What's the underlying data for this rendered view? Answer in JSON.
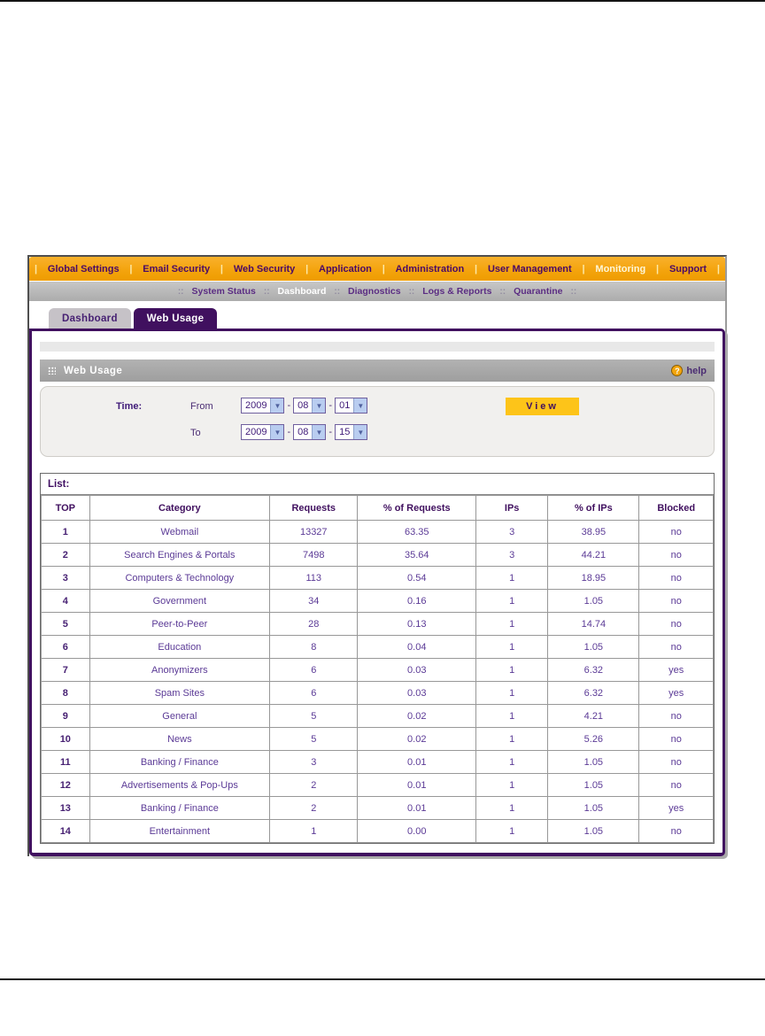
{
  "nav": {
    "separator": "|",
    "items": [
      {
        "label": "Global Settings",
        "active": false
      },
      {
        "label": "Email Security",
        "active": false
      },
      {
        "label": "Web Security",
        "active": false
      },
      {
        "label": "Application",
        "active": false
      },
      {
        "label": "Administration",
        "active": false
      },
      {
        "label": "User Management",
        "active": false
      },
      {
        "label": "Monitoring",
        "active": true
      },
      {
        "label": "Support",
        "active": false
      }
    ]
  },
  "subnav": {
    "separator": "::",
    "items": [
      {
        "label": "System Status",
        "active": false
      },
      {
        "label": "Dashboard",
        "active": true
      },
      {
        "label": "Diagnostics",
        "active": false
      },
      {
        "label": "Logs & Reports",
        "active": false
      },
      {
        "label": "Quarantine",
        "active": false
      }
    ]
  },
  "tabs": [
    {
      "label": "Dashboard",
      "active": false
    },
    {
      "label": "Web Usage",
      "active": true
    }
  ],
  "section": {
    "title": "Web Usage",
    "help_icon": "?",
    "help_label": "help"
  },
  "time_filter": {
    "label": "Time:",
    "from_label": "From",
    "to_label": "To",
    "separator": "-",
    "from": {
      "year": "2009",
      "month": "08",
      "day": "01"
    },
    "to": {
      "year": "2009",
      "month": "08",
      "day": "15"
    },
    "view_button": "View"
  },
  "list": {
    "label": "List:",
    "columns": [
      "TOP",
      "Category",
      "Requests",
      "% of Requests",
      "IPs",
      "% of IPs",
      "Blocked"
    ],
    "rows": [
      [
        "1",
        "Webmail",
        "13327",
        "63.35",
        "3",
        "38.95",
        "no"
      ],
      [
        "2",
        "Search Engines & Portals",
        "7498",
        "35.64",
        "3",
        "44.21",
        "no"
      ],
      [
        "3",
        "Computers & Technology",
        "113",
        "0.54",
        "1",
        "18.95",
        "no"
      ],
      [
        "4",
        "Government",
        "34",
        "0.16",
        "1",
        "1.05",
        "no"
      ],
      [
        "5",
        "Peer-to-Peer",
        "28",
        "0.13",
        "1",
        "14.74",
        "no"
      ],
      [
        "6",
        "Education",
        "8",
        "0.04",
        "1",
        "1.05",
        "no"
      ],
      [
        "7",
        "Anonymizers",
        "6",
        "0.03",
        "1",
        "6.32",
        "yes"
      ],
      [
        "8",
        "Spam Sites",
        "6",
        "0.03",
        "1",
        "6.32",
        "yes"
      ],
      [
        "9",
        "General",
        "5",
        "0.02",
        "1",
        "4.21",
        "no"
      ],
      [
        "10",
        "News",
        "5",
        "0.02",
        "1",
        "5.26",
        "no"
      ],
      [
        "11",
        "Banking / Finance",
        "3",
        "0.01",
        "1",
        "1.05",
        "no"
      ],
      [
        "12",
        "Advertisements & Pop-Ups",
        "2",
        "0.01",
        "1",
        "1.05",
        "no"
      ],
      [
        "13",
        "Banking / Finance",
        "2",
        "0.01",
        "1",
        "1.05",
        "yes"
      ],
      [
        "14",
        "Entertainment",
        "1",
        "0.00",
        "1",
        "1.05",
        "no"
      ]
    ]
  },
  "colors": {
    "nav_orange": "#f4a40e",
    "nav_text": "#4a0a66",
    "active_purple": "#40105f",
    "table_text": "#5b3a96",
    "view_button_gold": "#fdc419",
    "header_gray": "#a7a7a7"
  }
}
